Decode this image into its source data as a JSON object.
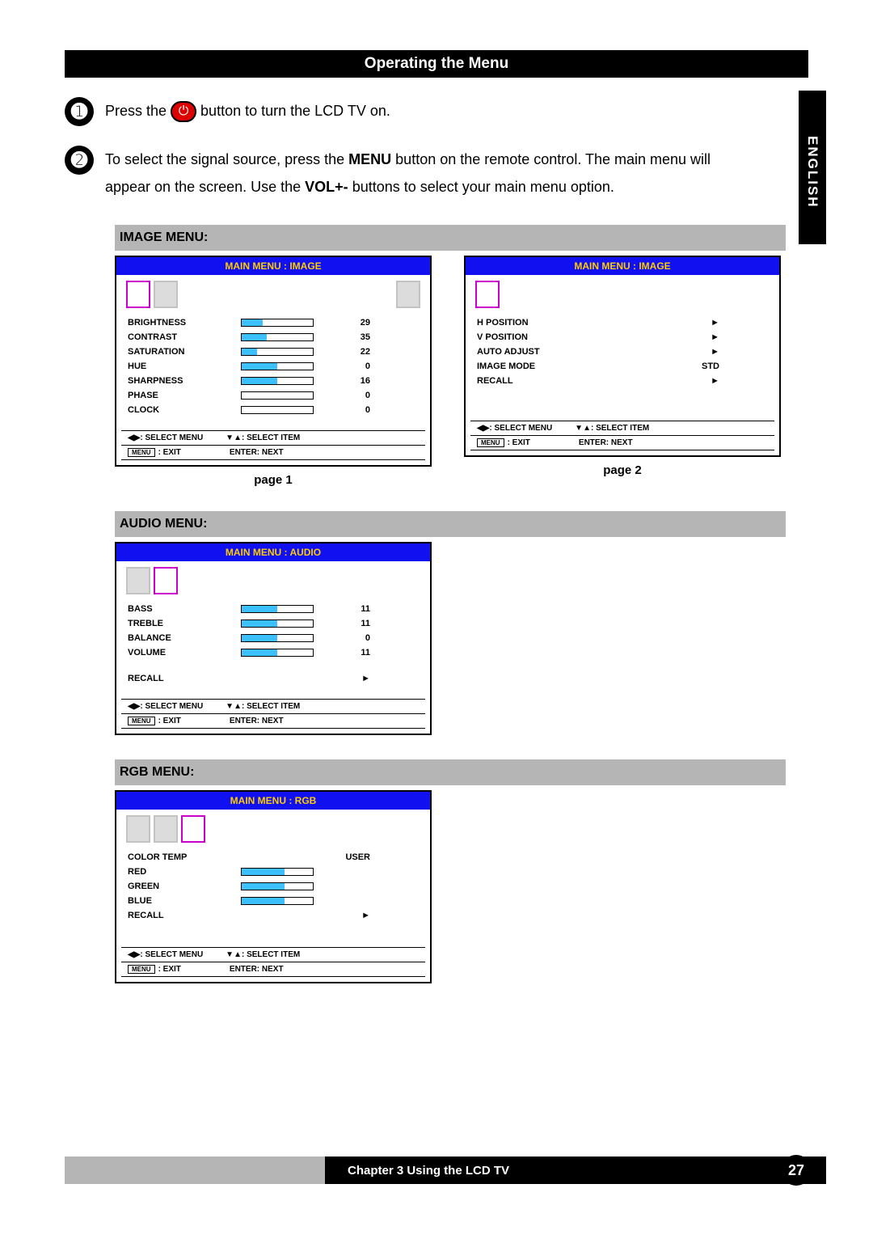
{
  "title": "Operating the Menu",
  "sideTab": "ENGLISH",
  "chapterText": "Chapter 3 Using the LCD TV",
  "pageNumber": "27",
  "step1": {
    "pre": "Press the ",
    "post": " button to turn the LCD TV on."
  },
  "step2": "To select the signal source, press the MENU button on the remote control. The main menu will appear on the screen. Use the VOL+- buttons to select your main menu option.",
  "sections": {
    "image": "IMAGE MENU:",
    "audio": "AUDIO MENU:",
    "rgb": "RGB MENU:"
  },
  "pages": {
    "p1": "page 1",
    "p2": "page 2"
  },
  "menuHeaders": {
    "image": "MAIN MENU : IMAGE",
    "audio": "MAIN MENU : AUDIO",
    "rgb": "MAIN MENU : RGB"
  },
  "image1": [
    {
      "label": "BRIGHTNESS",
      "value": "29",
      "fill": 29
    },
    {
      "label": "CONTRAST",
      "value": "35",
      "fill": 35
    },
    {
      "label": "SATURATION",
      "value": "22",
      "fill": 22
    },
    {
      "label": "HUE",
      "value": "0",
      "fill": 50
    },
    {
      "label": "SHARPNESS",
      "value": "16",
      "fill": 50
    },
    {
      "label": "PHASE",
      "value": "0",
      "fill": 0
    },
    {
      "label": "CLOCK",
      "value": "0",
      "fill": 0
    }
  ],
  "image2": [
    {
      "label": "H POSITION",
      "value": "►"
    },
    {
      "label": "V POSITION",
      "value": "►"
    },
    {
      "label": "AUTO ADJUST",
      "value": "►"
    },
    {
      "label": "IMAGE MODE",
      "value": "STD"
    },
    {
      "label": "RECALL",
      "value": "►"
    }
  ],
  "audio": [
    {
      "label": "BASS",
      "value": "11",
      "fill": 50
    },
    {
      "label": "TREBLE",
      "value": "11",
      "fill": 50
    },
    {
      "label": "BALANCE",
      "value": "0",
      "fill": 50
    },
    {
      "label": "VOLUME",
      "value": "11",
      "fill": 50
    }
  ],
  "audioExtra": {
    "label": "RECALL",
    "value": "►"
  },
  "rgb": [
    {
      "label": "COLOR TEMP",
      "value": "USER"
    },
    {
      "label": "RED",
      "value": "",
      "fill": 60
    },
    {
      "label": "GREEN",
      "value": "",
      "fill": 60
    },
    {
      "label": "BLUE",
      "value": "",
      "fill": 60
    },
    {
      "label": "RECALL",
      "value": "►"
    }
  ],
  "footer": {
    "selectMenu": "◀▶: SELECT MENU",
    "selectItem": "▼▲: SELECT ITEM",
    "menuExit": ": EXIT",
    "menuKey": "MENU",
    "enterNext": "ENTER: NEXT"
  }
}
